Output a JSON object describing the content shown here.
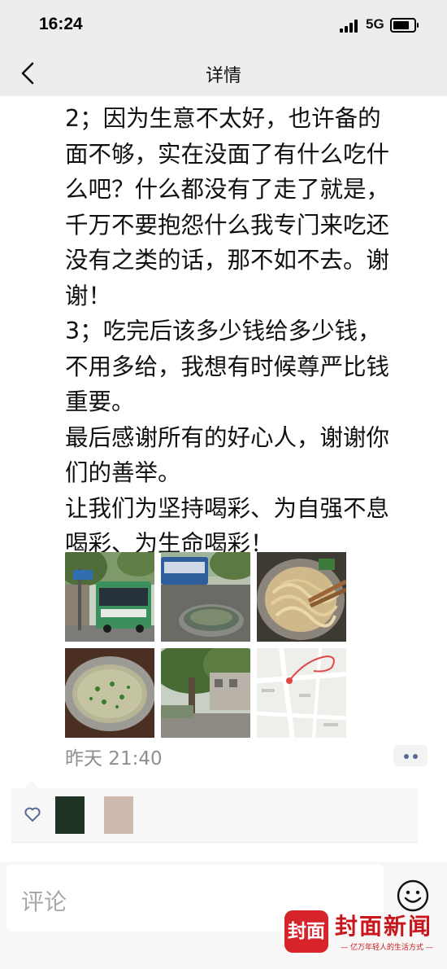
{
  "status_bar": {
    "time": "16:24",
    "network": "5G",
    "battery_level": 0.8
  },
  "nav": {
    "title": "详情"
  },
  "post": {
    "lines": [
      "2；因为生意不太好，也许备的",
      "面不够，实在没面了有什么吃什",
      "么吧？什么都没有了走了就是，",
      "千万不要抱怨什么我专门来吃还",
      "没有之类的话，那不如不去。谢",
      "谢！",
      "3；吃完后该多少钱给多少钱，",
      "不用多给，我想有时候尊严比钱",
      "重要。",
      "最后感谢所有的好心人，谢谢你",
      "们的善举。",
      "让我们为坚持喝彩、为自强不息",
      "喝彩、为生命喝彩！"
    ],
    "timestamp": "昨天 21:40",
    "photos": [
      {
        "name": "street-bus-photo"
      },
      {
        "name": "bus-and-bowl-photo"
      },
      {
        "name": "noodles-photo"
      },
      {
        "name": "soup-bowl-photo"
      },
      {
        "name": "tree-street-photo"
      },
      {
        "name": "map-photo"
      }
    ]
  },
  "comment": {
    "placeholder": "评论"
  },
  "watermark": {
    "badge": "封面",
    "name": "封面新闻",
    "slogan": "— 亿万年轻人的生活方式 —"
  },
  "colors": {
    "nav_bg": "#ededed",
    "link": "#576b95",
    "brand_red": "#d7232a",
    "timestamp": "#8f8f8f"
  },
  "icons": {
    "back": "chevron-left-icon",
    "like": "heart-icon",
    "more": "more-dots-icon",
    "emoji": "emoji-face-icon"
  }
}
